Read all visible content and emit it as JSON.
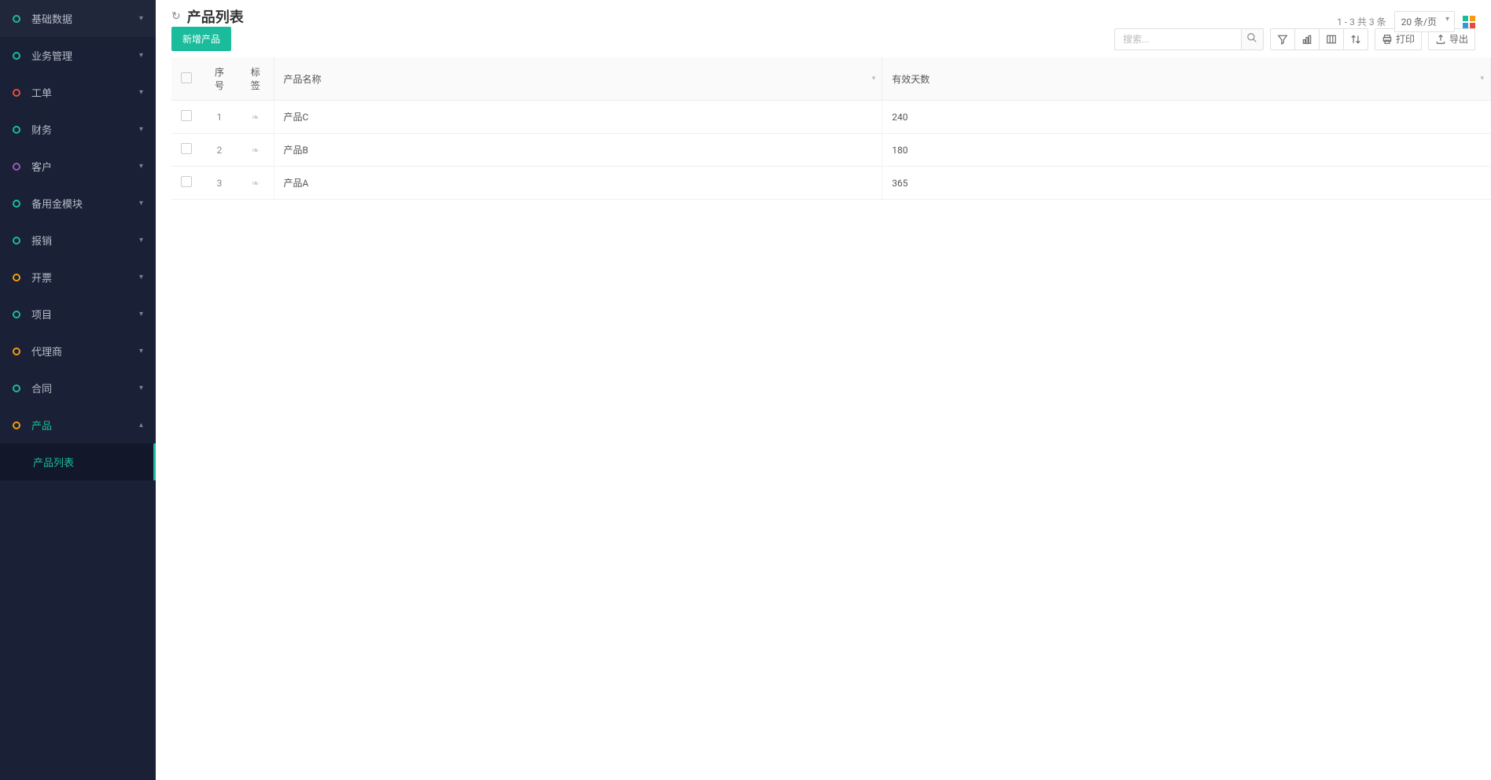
{
  "sidebar": {
    "items": [
      {
        "label": "基础数据",
        "circle": "circle-teal",
        "expanded": false
      },
      {
        "label": "业务管理",
        "circle": "circle-teal",
        "expanded": false
      },
      {
        "label": "工单",
        "circle": "circle-red",
        "expanded": false
      },
      {
        "label": "财务",
        "circle": "circle-teal",
        "expanded": false
      },
      {
        "label": "客户",
        "circle": "circle-purple",
        "expanded": false
      },
      {
        "label": "备用金模块",
        "circle": "circle-teal",
        "expanded": false
      },
      {
        "label": "报销",
        "circle": "circle-teal",
        "expanded": false
      },
      {
        "label": "开票",
        "circle": "circle-orange",
        "expanded": false
      },
      {
        "label": "项目",
        "circle": "circle-teal",
        "expanded": false
      },
      {
        "label": "代理商",
        "circle": "circle-orange",
        "expanded": false
      },
      {
        "label": "合同",
        "circle": "circle-teal",
        "expanded": false
      },
      {
        "label": "产品",
        "circle": "circle-orange",
        "expanded": true,
        "active": true
      }
    ],
    "subitem": "产品列表"
  },
  "page": {
    "title": "产品列表"
  },
  "toolbar": {
    "add_label": "新增产品",
    "search_placeholder": "搜索...",
    "print_label": "打印",
    "export_label": "导出"
  },
  "pagination": {
    "info": "1 - 3 共 3 条",
    "page_size": "20 条/页"
  },
  "table": {
    "headers": {
      "index": "序号",
      "tag": "标签",
      "name": "产品名称",
      "days": "有效天数"
    },
    "rows": [
      {
        "index": "1",
        "name": "产品C",
        "days": "240"
      },
      {
        "index": "2",
        "name": "产品B",
        "days": "180"
      },
      {
        "index": "3",
        "name": "产品A",
        "days": "365"
      }
    ]
  }
}
